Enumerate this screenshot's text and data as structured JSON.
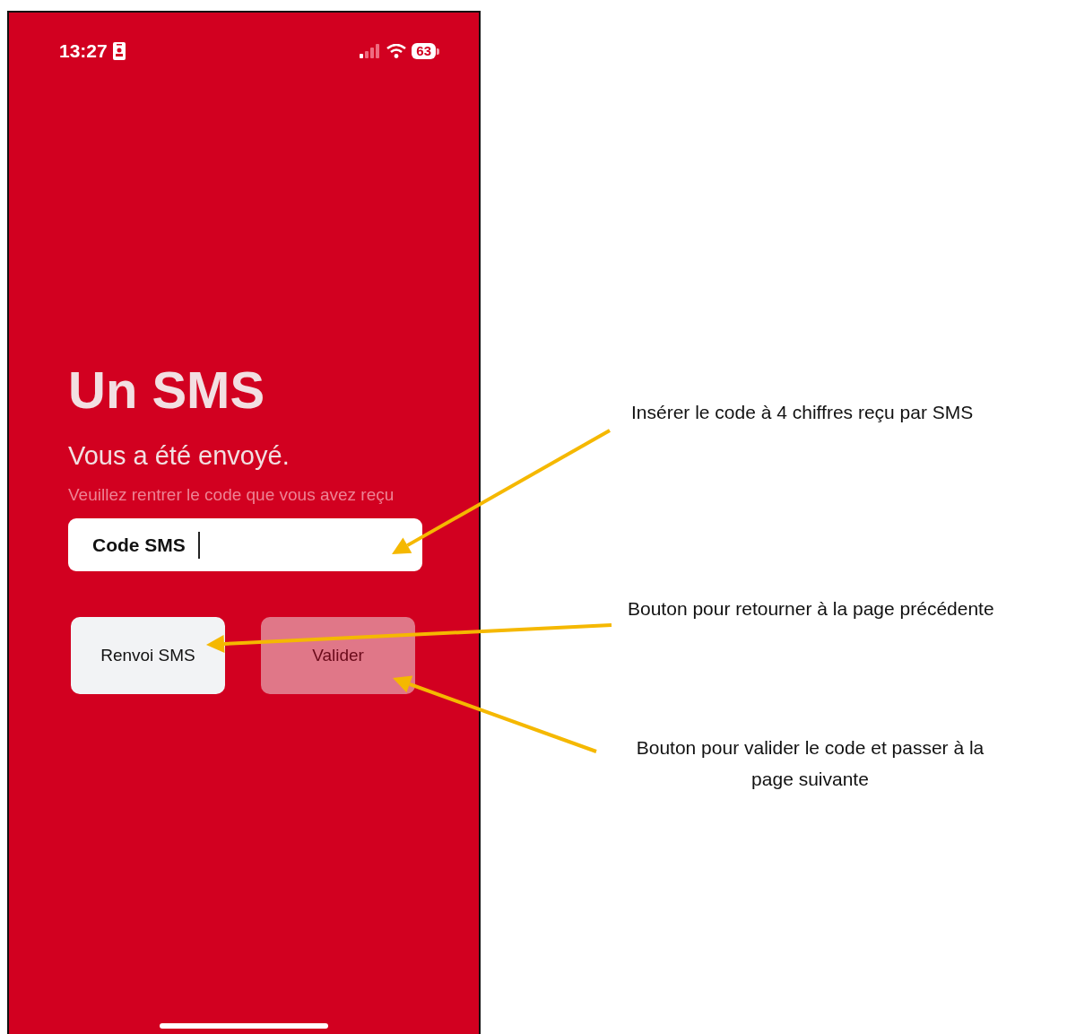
{
  "status_bar": {
    "time": "13:27",
    "battery": "63"
  },
  "title": "Un SMS",
  "subtitle": "Vous a été envoyé.",
  "hint": "Veuillez rentrer le code que vous avez reçu",
  "code_field": {
    "label": "Code SMS"
  },
  "buttons": [
    {
      "label": "Renvoi SMS",
      "kind": "secondary",
      "disabled": false
    },
    {
      "label": "Valider",
      "kind": "primary",
      "disabled": true
    }
  ],
  "annotations": [
    {
      "text": "Insérer le code à 4 chiffres reçu par SMS"
    },
    {
      "text": "Bouton pour retourner à la page précédente"
    },
    {
      "text": "Bouton pour valider le code et passer à la page suivante"
    }
  ]
}
